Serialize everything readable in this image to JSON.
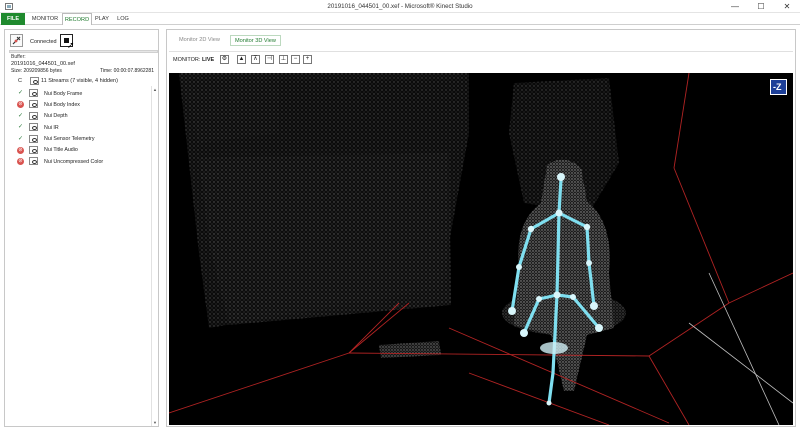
{
  "window": {
    "title": "20191016_044501_00.xef - Microsoft® Kinect Studio",
    "minimize": "—",
    "maximize": "☐",
    "close": "✕"
  },
  "menu": {
    "file": "FILE",
    "monitor": "MONITOR",
    "record": "RECORD",
    "play": "PLAY",
    "log": "LOG"
  },
  "record_panel": {
    "status": "Connected",
    "buffer_label": "Buffer:",
    "file_name": "20191016_044501_00.xef",
    "size": "Size: 209209856 bytes",
    "time": "Time: 00:00:07.8962281",
    "streams_col": "C",
    "streams_summary": "11 Streams (7 visible, 4 hidden)",
    "streams": [
      {
        "name": "Nui Body Frame",
        "state": "on"
      },
      {
        "name": "Nui Body Index",
        "state": "off"
      },
      {
        "name": "Nui Depth",
        "state": "on"
      },
      {
        "name": "Nui IR",
        "state": "on"
      },
      {
        "name": "Nui Sensor Telemetry",
        "state": "on"
      },
      {
        "name": "Nui Title Audio",
        "state": "off"
      },
      {
        "name": "Nui Uncompressed Color",
        "state": "off"
      }
    ]
  },
  "view": {
    "tab_2d": "Monitor 2D View",
    "tab_3d": "Monitor 3D View",
    "monitor_label": "MONITOR:",
    "monitor_state": "LIVE",
    "axis_label": "-Z"
  },
  "colors": {
    "accent_green": "#1f8a2e",
    "skeleton": "#7fdff0",
    "bounds": "#b02323"
  }
}
